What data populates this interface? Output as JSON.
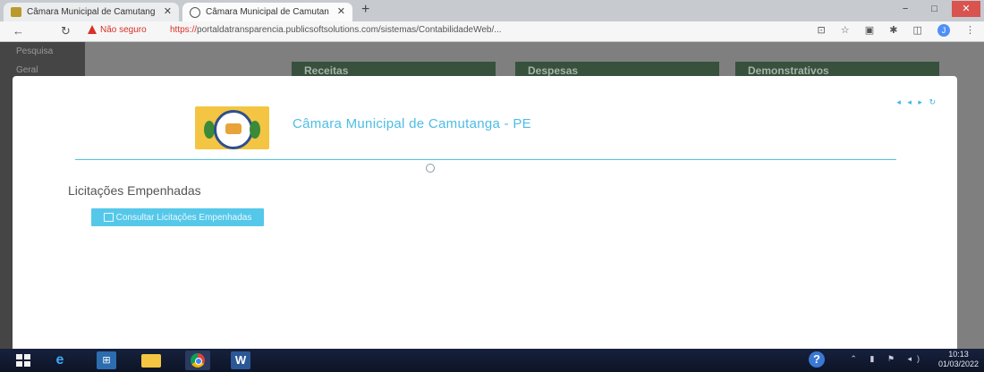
{
  "browser": {
    "tabs": [
      {
        "label": "Câmara Municipal de Camutang",
        "favicon": "brand-logo-icon",
        "active": false
      },
      {
        "label": "Câmara Municipal de Camutan",
        "favicon": "globe-icon",
        "active": true
      }
    ],
    "new_tab": "+",
    "window_controls": {
      "minimize": "−",
      "maximize": "□",
      "close": "✕"
    },
    "address": {
      "security_label": "Não seguro",
      "url_scheme": "https://",
      "url_rest": "portaldatransparencia.publicsoftsolutions.com/sistemas/ContabilidadeWeb/..."
    },
    "profile_initial": "J"
  },
  "background": {
    "sidebar_items": [
      "Pesquisa",
      "Geral"
    ],
    "panels": [
      "Receitas",
      "Despesas",
      "Demonstrativos"
    ]
  },
  "modal": {
    "org_title": "Câmara Municipal de Camutanga - PE",
    "section_title": "Licitações Empenhadas",
    "consult_button": "Consultar Licitações Empenhadas",
    "tools": [
      "◂",
      "◂",
      "▸",
      "↻"
    ]
  },
  "taskbar": {
    "help_glyph": "?",
    "tray_icons": "⌃ ▮ ⚑ ◂)",
    "time": "10:13",
    "date": "01/03/2022"
  },
  "colors": {
    "accent": "#4dbde4",
    "button": "#55c8ea",
    "panel": "#37513d",
    "insecure": "#d93025"
  }
}
